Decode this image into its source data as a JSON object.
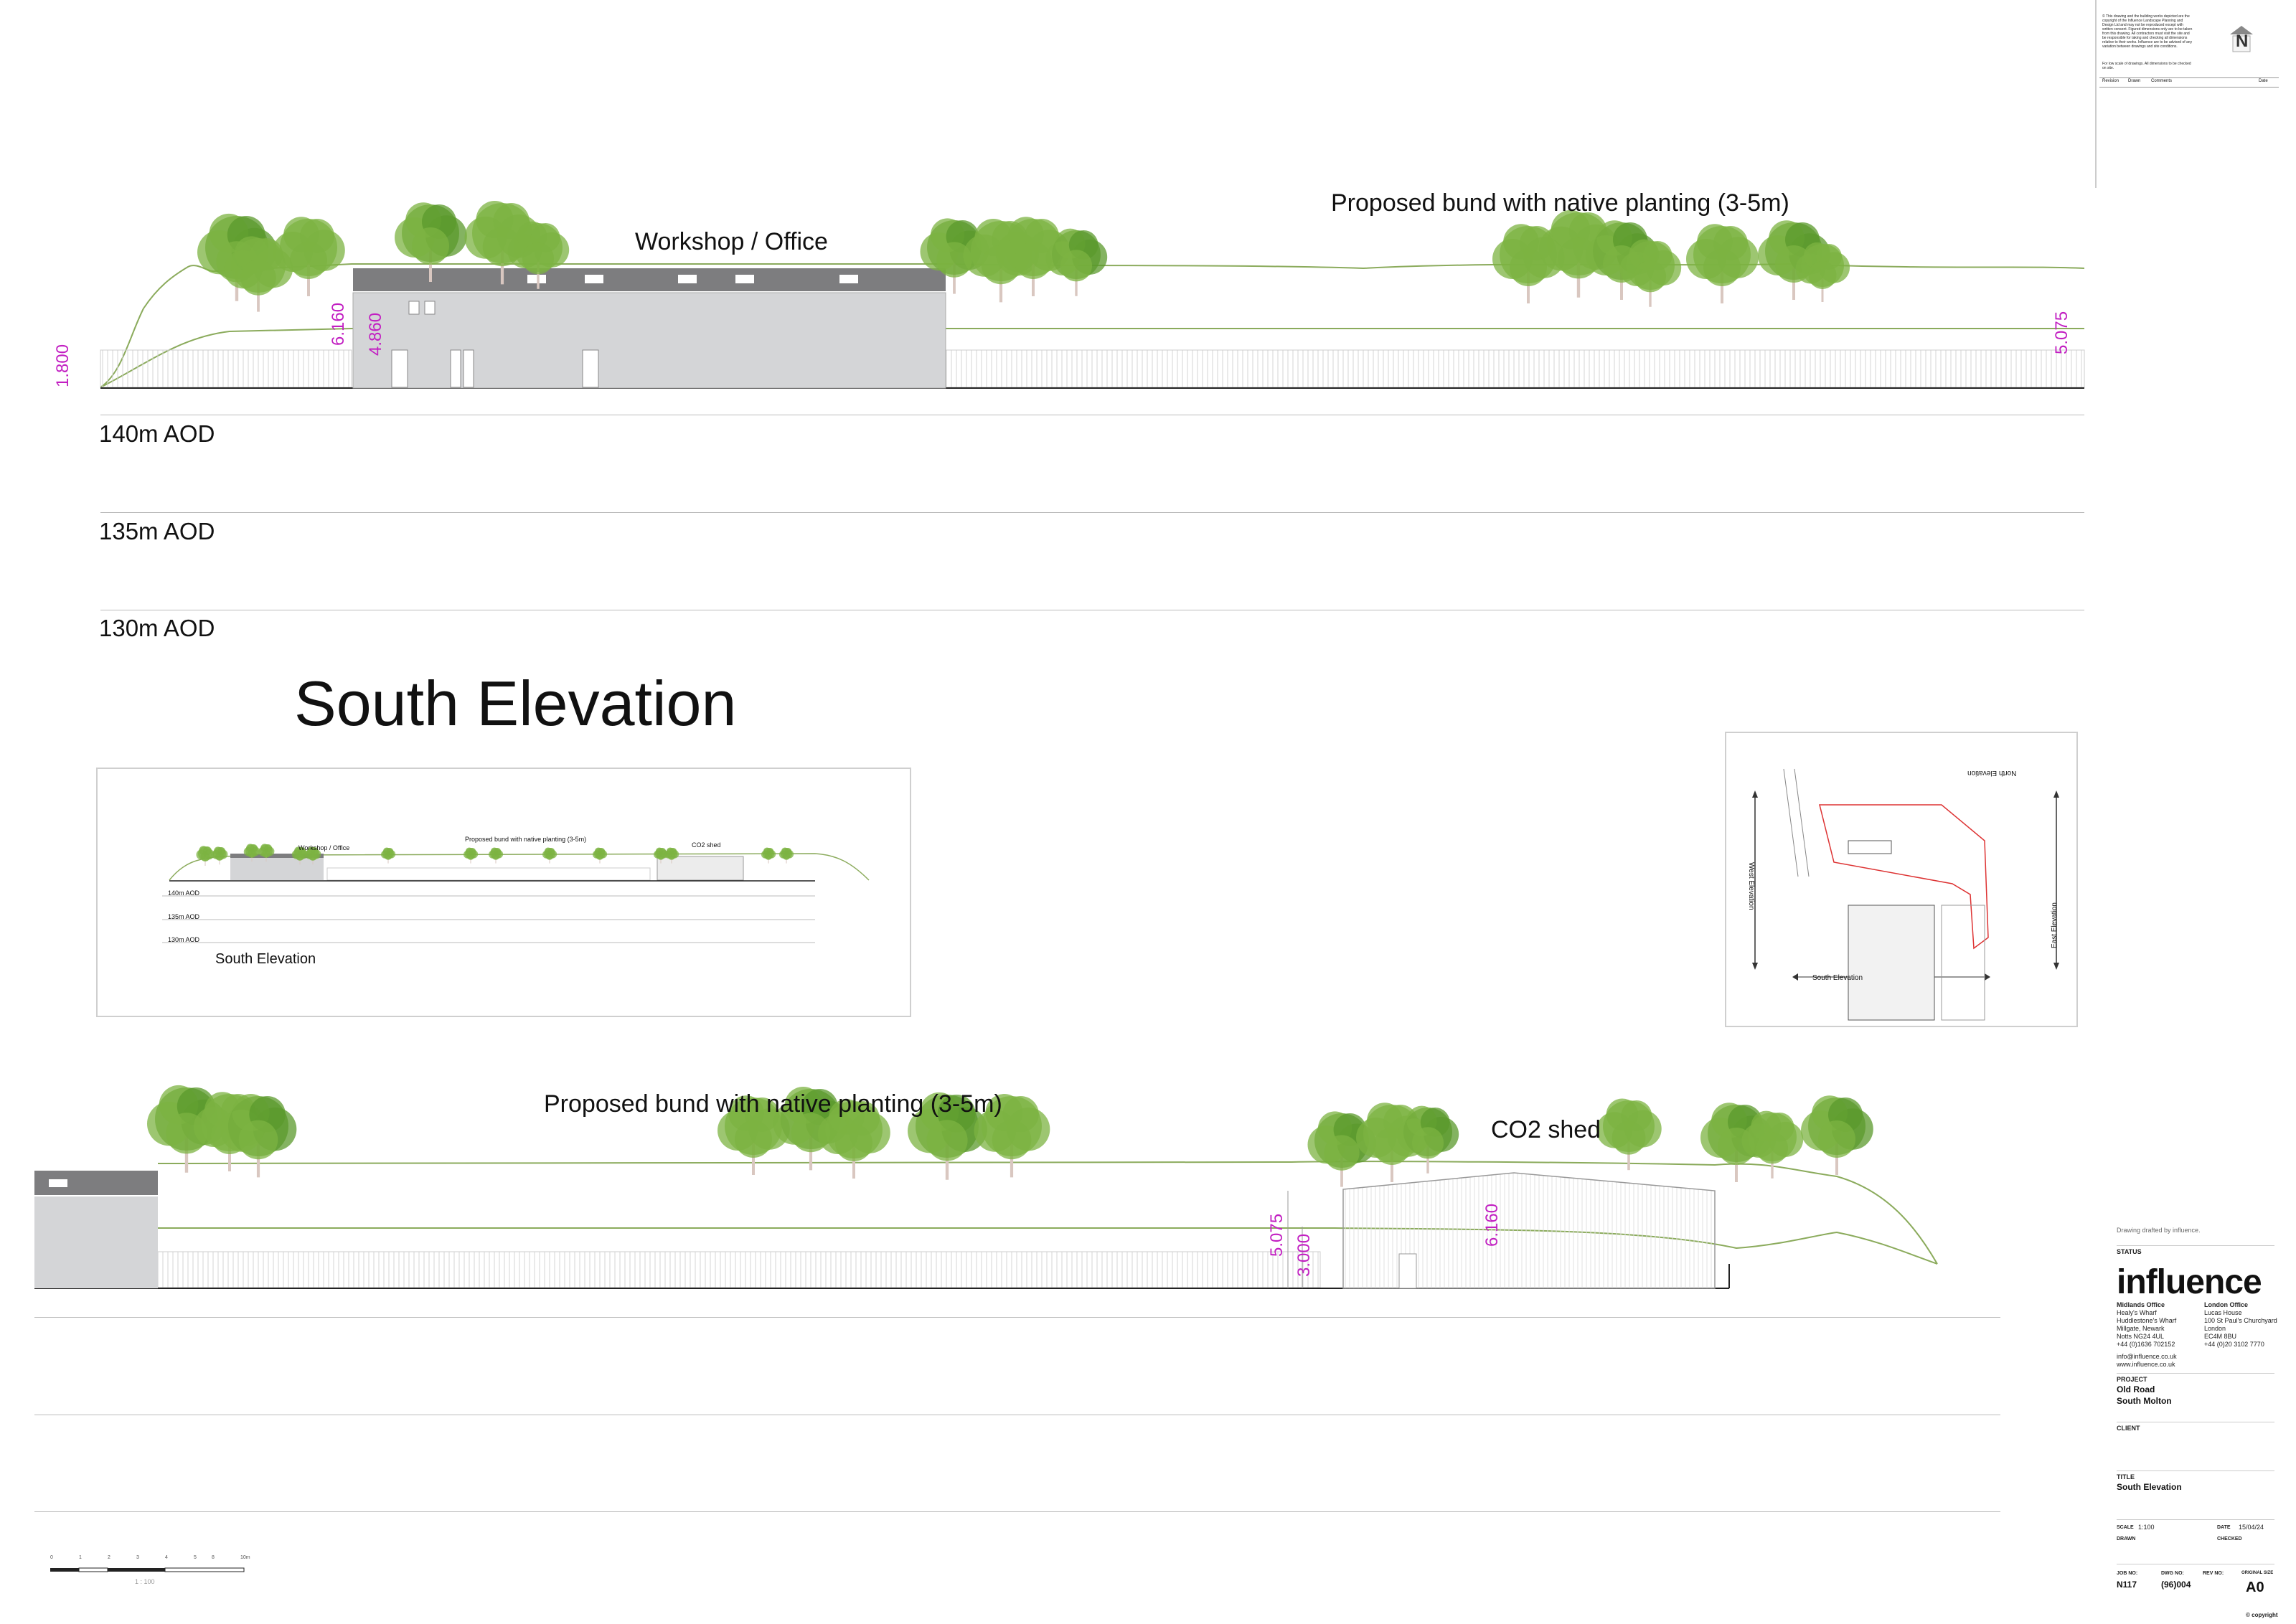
{
  "drawing": {
    "main_title": "South Elevation",
    "upper": {
      "building_label": "Workshop / Office",
      "bund_label": "Proposed bund with native planting (3-5m)",
      "dims": [
        "1.800",
        "6.160",
        "4.860",
        "5.075"
      ],
      "aod_levels": [
        "140m AOD",
        "135m AOD",
        "130m AOD"
      ]
    },
    "lower": {
      "bund_label": "Proposed bund with native planting (3-5m)",
      "shed_label": "CO2 shed",
      "dims": [
        "5.075",
        "3.000",
        "6.160"
      ]
    },
    "thumbnail": {
      "building_label": "Workshop / Office",
      "bund_label": "Proposed bund with native planting (3-5m)",
      "shed_label": "CO2 shed",
      "aod_levels": [
        "140m AOD",
        "135m AOD",
        "130m AOD"
      ],
      "caption": "South Elevation"
    },
    "key_plan": {
      "north": "North Elevation",
      "west": "West Elevation",
      "east": "East Elevation",
      "south": "South Elevation"
    },
    "scale_bar": {
      "ticks": [
        "0",
        "1",
        "2",
        "3",
        "4",
        "5",
        "8",
        "10m"
      ],
      "label": "1 : 100"
    },
    "colors": {
      "tree": "#7cb342",
      "tree_dark": "#5b9a2c",
      "bund_line": "#8bab5c",
      "building_fill": "#d4d5d7",
      "roof": "#7d7d7f",
      "dimension": "#c21fc2"
    }
  },
  "title_block": {
    "notes": "© This drawing and the building works depicted are the copyright of the Influence Landscape Planning and Design Ltd and may not be reproduced except with written consent. Figured dimensions only are to be taken from this drawing. All contractors must visit the site and be responsible for taking and checking all dimensions relative to their works. Influence are to be advised of any variation between drawings and site conditions.",
    "notes2": "For low scale of drawings. All dimensions to be checked on site.",
    "north_letter": "N",
    "revision_headers": [
      "Revision",
      "Drawn",
      "Comments",
      "Date"
    ],
    "drafted_by": "Drawing drafted by influence.",
    "status_label": "STATUS",
    "logo": "influence",
    "midlands": {
      "heading": "Midlands Office",
      "lines": [
        "Healy's Wharf",
        "Huddlestone's Wharf",
        "Millgate, Newark",
        "Notts NG24 4UL",
        "+44 (0)1636 702152"
      ]
    },
    "london": {
      "heading": "London Office",
      "lines": [
        "Lucas House",
        "100 St Paul's Churchyard",
        "London",
        "EC4M 8BU",
        "+44 (0)20 3102 7770"
      ]
    },
    "email": "info@influence.co.uk",
    "web": "www.influence.co.uk",
    "project_label": "PROJECT",
    "project_lines": [
      "Old Road",
      "South Molton"
    ],
    "client_label": "CLIENT",
    "title_label": "TITLE",
    "title_value": "South Elevation",
    "scale_label": "SCALE",
    "scale_value": "1:100",
    "date_label": "DATE",
    "date_value": "15/04/24",
    "drawn_label": "DRAWN",
    "checked_label": "CHECKED",
    "job_label": "JOB NO:",
    "job_value": "N117",
    "dwg_label": "DWG NO:",
    "dwg_value": "(96)004",
    "rev_label": "REV NO:",
    "size_label": "ORIGINAL SIZE",
    "size_value": "A0",
    "copyright": "© copyright"
  }
}
